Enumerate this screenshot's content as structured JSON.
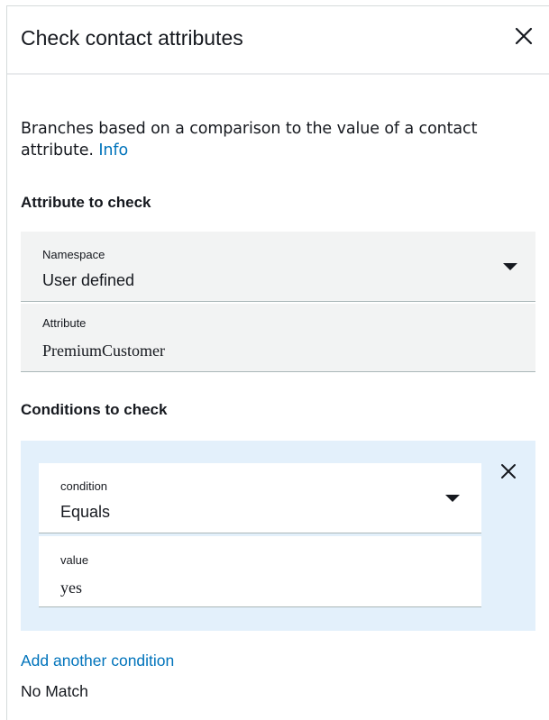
{
  "header": {
    "title": "Check contact attributes",
    "close_icon": "close-icon"
  },
  "description": {
    "text": "Branches based on a comparison to the value of a contact attribute.",
    "info_link": "Info"
  },
  "attribute_section": {
    "label": "Attribute to check",
    "namespace": {
      "label": "Namespace",
      "value": "User defined",
      "icon": "caret-down-icon"
    },
    "attribute": {
      "label": "Attribute",
      "value": "PremiumCustomer"
    }
  },
  "conditions_section": {
    "label": "Conditions to check",
    "remove_icon": "close-icon",
    "condition": {
      "label": "condition",
      "value": "Equals",
      "icon": "caret-down-icon"
    },
    "value": {
      "label": "value",
      "value": "yes"
    }
  },
  "add_condition_link": "Add another condition",
  "no_match_label": "No Match",
  "colors": {
    "link": "#0073bb",
    "text": "#16191f",
    "field_bg": "#f2f3f3",
    "condition_bg": "#e3f0fb"
  }
}
